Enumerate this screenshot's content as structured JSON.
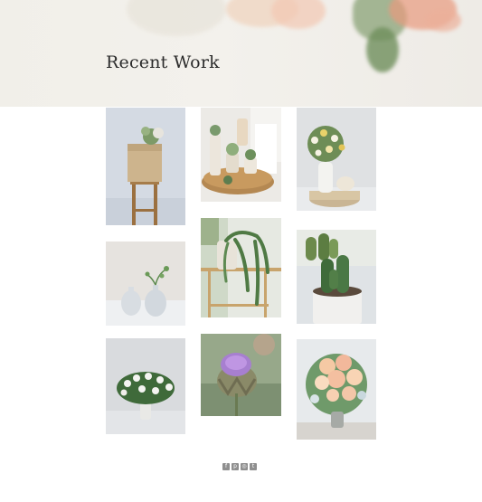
{
  "header": {
    "title": "Recent Work"
  },
  "gallery": [
    {
      "name": "gallery-image-1",
      "subject": "bag-on-stool"
    },
    {
      "name": "gallery-image-2",
      "subject": "tray-succulents"
    },
    {
      "name": "gallery-image-3",
      "subject": "flower-bouquet-pumpkins"
    },
    {
      "name": "gallery-image-4",
      "subject": "white-vases"
    },
    {
      "name": "gallery-image-5",
      "subject": "string-of-pearls"
    },
    {
      "name": "gallery-image-6",
      "subject": "cactus-pot"
    },
    {
      "name": "gallery-image-7",
      "subject": "white-flower-vase"
    },
    {
      "name": "gallery-image-8",
      "subject": "artichoke-flower"
    },
    {
      "name": "gallery-image-9",
      "subject": "rose-bouquet"
    }
  ],
  "social": {
    "icons": [
      "facebook-icon",
      "pinterest-icon",
      "instagram-icon",
      "twitter-icon"
    ],
    "glyphs": [
      "f",
      "p",
      "◎",
      "t"
    ]
  },
  "colors": {
    "social_icon_bg": "#8f8f8f",
    "title": "#2b2b2b"
  }
}
